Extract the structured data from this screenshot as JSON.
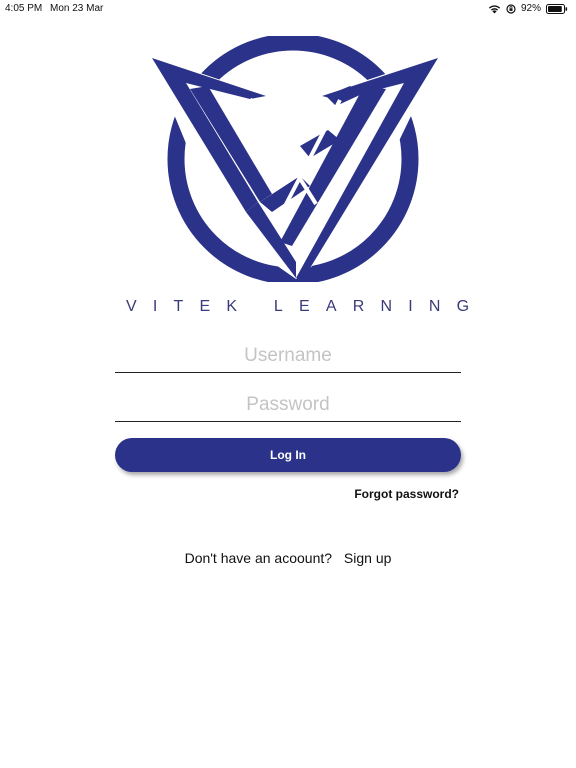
{
  "status_bar": {
    "time": "4:05 PM",
    "date": "Mon 23 Mar",
    "battery_percent": "92%",
    "battery_level": 0.92,
    "icons": [
      "wifi-icon",
      "orientation-lock-icon",
      "battery-icon"
    ]
  },
  "brand": {
    "name": "VITEK LEARNING",
    "color": "#2b3289"
  },
  "login_form": {
    "username_placeholder": "Username",
    "username_value": "",
    "password_placeholder": "Password",
    "password_value": "",
    "login_label": "Log In",
    "forgot_label": "Forgot password?"
  },
  "signup": {
    "prompt": "Don't have an acoount?",
    "link_label": "Sign up"
  },
  "colors": {
    "accent": "#2b3289",
    "text": "#111111",
    "placeholder": "#c4c4c4"
  }
}
